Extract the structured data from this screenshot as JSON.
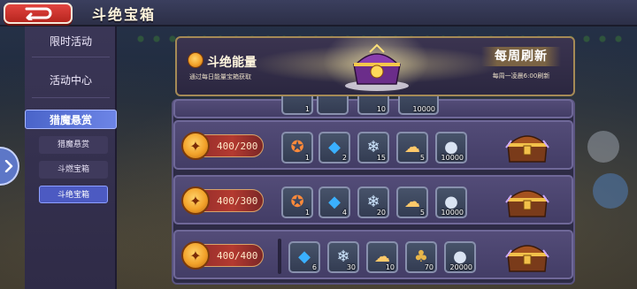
{
  "header": {
    "title": "斗绝宝箱"
  },
  "sidebar": {
    "items": [
      {
        "label": "限时活动"
      },
      {
        "label": "活动中心"
      },
      {
        "label": "猎魔悬赏"
      }
    ],
    "sub_items": [
      {
        "label": "猎魔悬赏"
      },
      {
        "label": "斗燃宝箱"
      },
      {
        "label": "斗绝宝箱"
      }
    ]
  },
  "banner": {
    "name": "斗绝能量",
    "subtitle": "通过每日能量宝箱获取",
    "weekly_title": "每周刷新",
    "weekly_sub": "每周一凌晨6:00刷新"
  },
  "rows": [
    {
      "requirement": "",
      "items": [
        {
          "icon": "badge-icon",
          "qty": "1"
        },
        {
          "icon": "gem-icon",
          "qty": ""
        },
        {
          "icon": "crystal-icon",
          "qty": "10"
        },
        {
          "icon": "coins-icon",
          "qty": "10000"
        }
      ]
    },
    {
      "requirement": "400/200",
      "items": [
        {
          "icon": "badge-icon",
          "qty": "1"
        },
        {
          "icon": "gem-icon",
          "qty": "2"
        },
        {
          "icon": "crystal-icon",
          "qty": "15"
        },
        {
          "icon": "gold-ore-icon",
          "qty": "5"
        },
        {
          "icon": "coins-icon",
          "qty": "10000"
        }
      ]
    },
    {
      "requirement": "400/300",
      "items": [
        {
          "icon": "badge-icon",
          "qty": "1"
        },
        {
          "icon": "gem-icon",
          "qty": "4"
        },
        {
          "icon": "crystal-icon",
          "qty": "20"
        },
        {
          "icon": "gold-ore-icon",
          "qty": "5"
        },
        {
          "icon": "coins-icon",
          "qty": "10000"
        }
      ]
    },
    {
      "requirement": "400/400",
      "items": [
        {
          "icon": "gem-icon",
          "qty": "6"
        },
        {
          "icon": "crystal-icon",
          "qty": "30"
        },
        {
          "icon": "gold-ore-icon",
          "qty": "10"
        },
        {
          "icon": "treasure-bag-icon",
          "qty": "70"
        },
        {
          "icon": "coins-icon",
          "qty": "20000"
        }
      ]
    }
  ],
  "colors": {
    "accent_blue": "#4a64c9",
    "back_red": "#e2443f",
    "panel_purple": "#534c78",
    "gold": "#f2a22a"
  }
}
